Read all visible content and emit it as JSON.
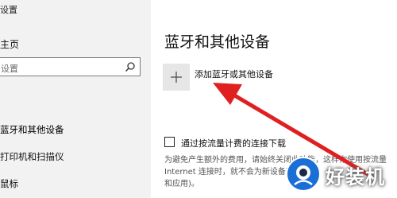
{
  "sidebar": {
    "settings_title": "设置",
    "home_label": "主页",
    "search_placeholder": "设置",
    "items": [
      {
        "label": "蓝牙和其他设备",
        "active": true
      },
      {
        "label": "打印机和扫描仪",
        "active": false
      },
      {
        "label": "鼠标",
        "active": false
      }
    ]
  },
  "main": {
    "title": "蓝牙和其他设备",
    "add_device_label": "添加蓝牙或其他设备",
    "metered": {
      "label": "通过按流量计费的连接下载",
      "checked": false
    },
    "description_lines": [
      "为避免产生额外的费用，请始终关闭此功能，这样你使用按流量",
      "Internet 连接时，就不会为新设备下载",
      "和应用)。"
    ]
  },
  "watermark": {
    "text": "好装机"
  },
  "colors": {
    "sidebar_bg": "#f2f2f2",
    "arrow": "#e02020",
    "plus_tile": "#e6e6e6",
    "watermark_blue": "#1a6fd6"
  }
}
